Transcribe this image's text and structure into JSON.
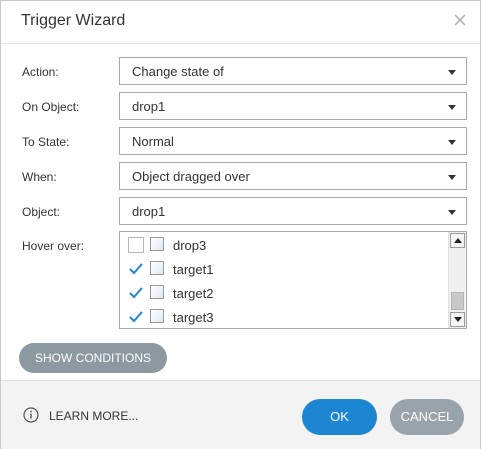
{
  "dialog": {
    "title": "Trigger Wizard",
    "close_icon": "close-icon"
  },
  "form": {
    "action": {
      "label": "Action:",
      "value": "Change state of"
    },
    "on_object": {
      "label": "On Object:",
      "value": "drop1"
    },
    "to_state": {
      "label": "To State:",
      "value": "Normal"
    },
    "when": {
      "label": "When:",
      "value": "Object dragged over"
    },
    "object": {
      "label": "Object:",
      "value": "drop1"
    },
    "hover_over": {
      "label": "Hover over:",
      "items": [
        {
          "label": "drop3",
          "checked": false
        },
        {
          "label": "target1",
          "checked": true
        },
        {
          "label": "target2",
          "checked": true
        },
        {
          "label": "target3",
          "checked": true
        }
      ]
    }
  },
  "buttons": {
    "show_conditions": "SHOW CONDITIONS",
    "learn_more": "LEARN MORE...",
    "ok": "OK",
    "cancel": "CANCEL"
  },
  "colors": {
    "primary": "#1c86d3",
    "secondary": "#99a3ab",
    "show_conditions_bg": "#8c99a1",
    "checkmark": "#1c86d3"
  }
}
